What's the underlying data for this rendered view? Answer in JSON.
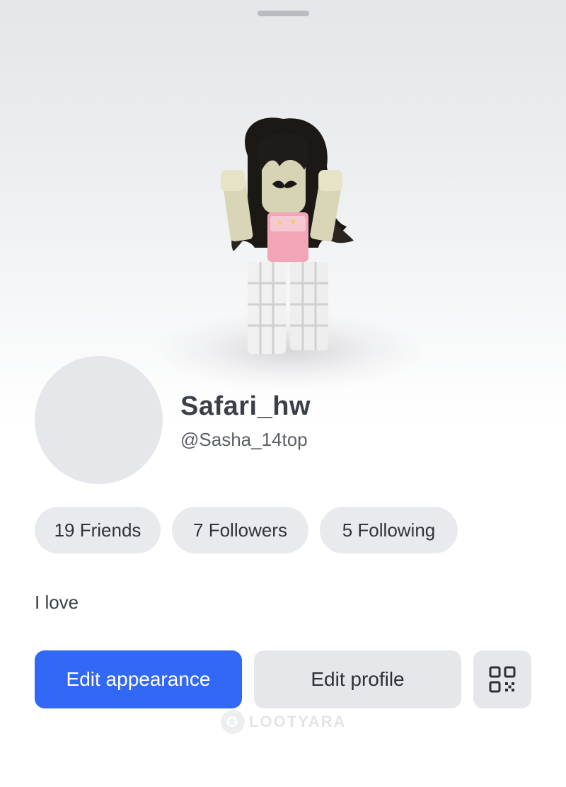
{
  "profile": {
    "display_name": "Safari_hw",
    "username": "@Sasha_14top",
    "bio": "I love"
  },
  "stats": {
    "friends_label": "19 Friends",
    "followers_label": "7 Followers",
    "following_label": "5 Following"
  },
  "actions": {
    "edit_appearance_label": "Edit appearance",
    "edit_profile_label": "Edit profile",
    "qr_icon": "qr-code-icon"
  },
  "watermark": {
    "text": "LOOTYARA"
  },
  "colors": {
    "primary": "#3268f6",
    "pill_bg": "#e9eaed",
    "text_dark": "#3b3f48"
  }
}
